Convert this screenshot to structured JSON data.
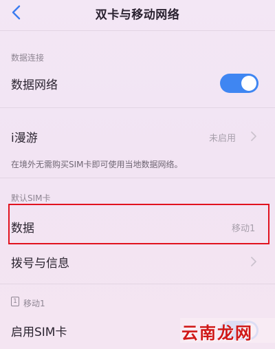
{
  "nav": {
    "title": "双卡与移动网络",
    "back_icon": "chevron-left-icon"
  },
  "data_connection": {
    "section_label": "数据连接",
    "mobile_data_label": "数据网络",
    "mobile_data_enabled": true
  },
  "roaming": {
    "label": "i漫游",
    "status": "未启用",
    "description": "在境外无需购买SIM卡即可使用当地数据网络。"
  },
  "default_sim": {
    "section_label": "默认SIM卡",
    "data_label": "数据",
    "data_value": "移动1",
    "calls_label": "拨号与信息"
  },
  "sim1": {
    "slot_number": "1",
    "section_label": "移动1",
    "enable_label": "启用SIM卡",
    "enabled": true
  },
  "watermark": {
    "text": "云南龙网"
  },
  "colors": {
    "toggle_on": "#3f86f2",
    "highlight": "#e1121e",
    "watermark": "#d01818"
  }
}
